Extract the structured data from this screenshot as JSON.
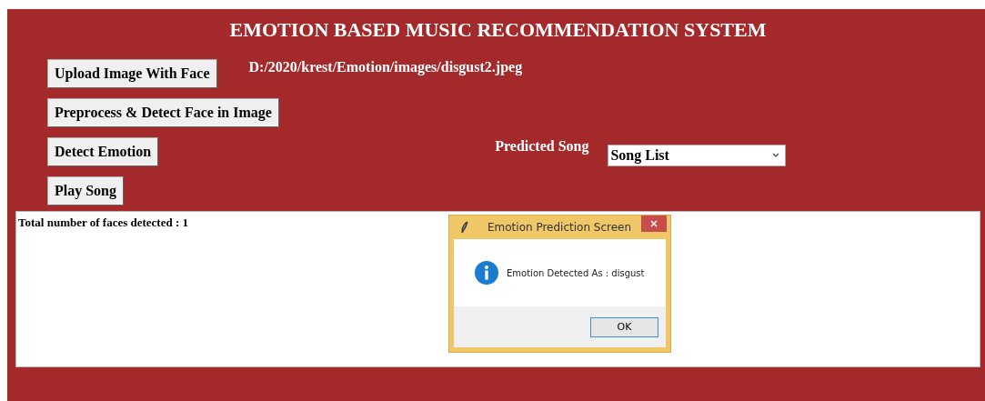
{
  "title": "EMOTION BASED MUSIC RECOMMENDATION SYSTEM",
  "buttons": [
    {
      "label": "Upload Image With Face"
    },
    {
      "label": "Preprocess & Detect Face in Image"
    },
    {
      "label": "Detect Emotion"
    },
    {
      "label": "Play Song"
    }
  ],
  "image_path": "D:/2020/krest/Emotion/images/disgust2.jpeg",
  "predicted_song": {
    "label": "Predicted Song",
    "value": "Song List"
  },
  "output_text": "Total number of faces detected : 1",
  "dialog": {
    "title": "Emotion Prediction Screen",
    "message": "Emotion Detected As : disgust",
    "button": "OK"
  }
}
